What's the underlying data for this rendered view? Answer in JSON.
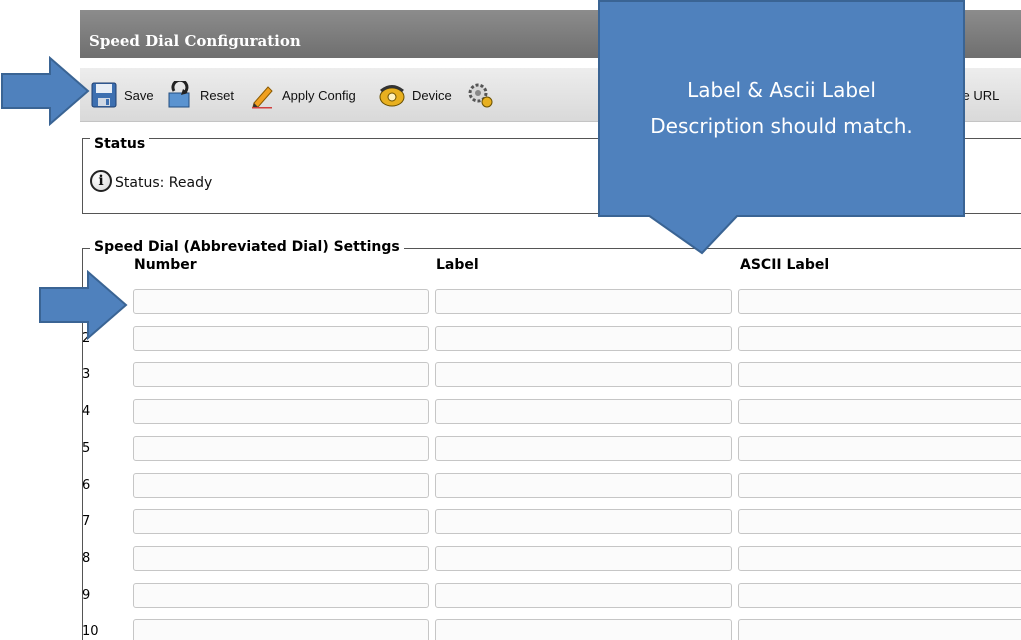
{
  "window": {
    "title": "Speed Dial Configuration"
  },
  "toolbar": {
    "items": [
      {
        "label": "Save",
        "icon": "save-icon"
      },
      {
        "label": "Reset",
        "icon": "reset-icon"
      },
      {
        "label": "Apply Config",
        "icon": "pencil-icon"
      },
      {
        "label": "Device",
        "icon": "phone-icon"
      },
      {
        "label": "",
        "icon": "gear-icon"
      },
      {
        "label": "ce URL",
        "icon": ""
      }
    ]
  },
  "status": {
    "legend": "Status",
    "text": "Status: Ready",
    "icon": "info-icon"
  },
  "speed_dial": {
    "legend": "Speed Dial (Abbreviated Dial) Settings",
    "columns": [
      "Number",
      "Label",
      "ASCII Label"
    ],
    "rows": [
      {
        "index": "",
        "number": "",
        "label": "",
        "ascii_label": ""
      },
      {
        "index": "2",
        "number": "",
        "label": "",
        "ascii_label": ""
      },
      {
        "index": "3",
        "number": "",
        "label": "",
        "ascii_label": ""
      },
      {
        "index": "4",
        "number": "",
        "label": "",
        "ascii_label": ""
      },
      {
        "index": "5",
        "number": "",
        "label": "",
        "ascii_label": ""
      },
      {
        "index": "6",
        "number": "",
        "label": "",
        "ascii_label": ""
      },
      {
        "index": "7",
        "number": "",
        "label": "",
        "ascii_label": ""
      },
      {
        "index": "8",
        "number": "",
        "label": "",
        "ascii_label": ""
      },
      {
        "index": "9",
        "number": "",
        "label": "",
        "ascii_label": ""
      },
      {
        "index": "10",
        "number": "",
        "label": "",
        "ascii_label": ""
      }
    ]
  },
  "callout": {
    "line1": "Label & Ascii Label",
    "line2": "Description should match.",
    "color": "#4f81bd"
  },
  "annotation_arrow_color": "#4f81bd"
}
